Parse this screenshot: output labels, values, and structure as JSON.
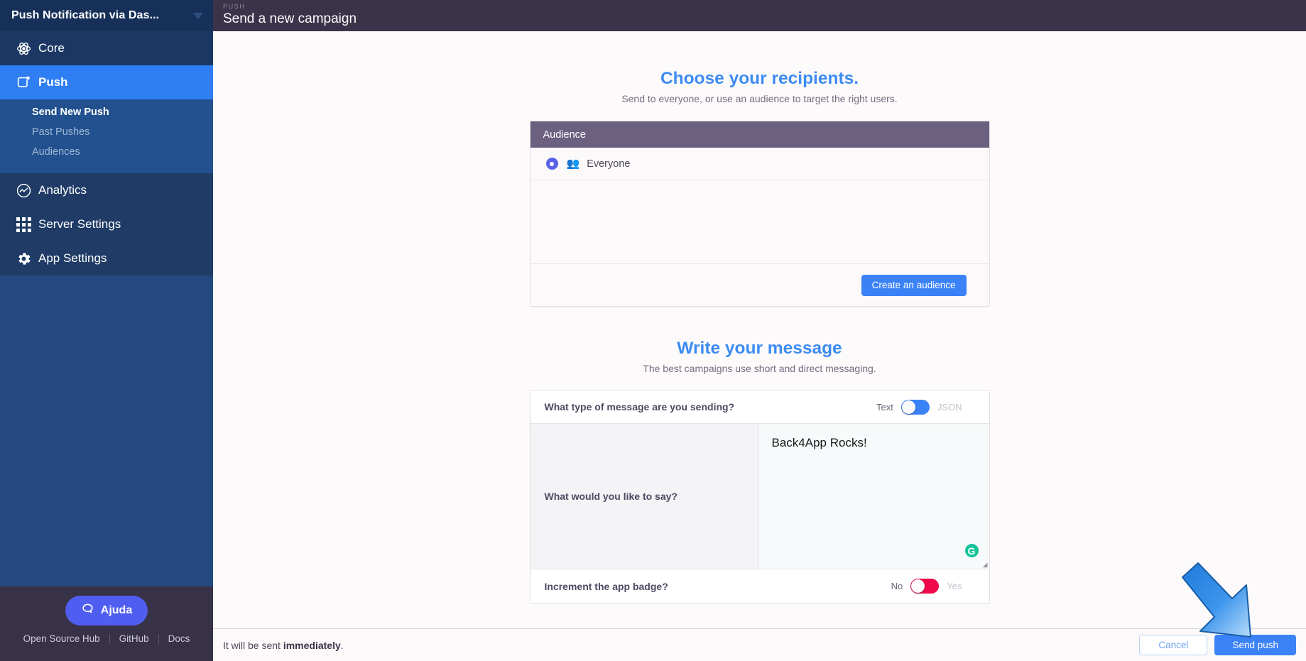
{
  "sidebar": {
    "app_title": "Push Notification via Das...",
    "dropdown_icon": "chevron-down-icon",
    "nav": [
      {
        "label": "Core",
        "icon": "atom-icon",
        "active": false
      },
      {
        "label": "Push",
        "icon": "push-bell-icon",
        "active": true
      },
      {
        "label": "Analytics",
        "icon": "analytics-chart-icon",
        "active": false
      },
      {
        "label": "Server Settings",
        "icon": "grid-apps-icon",
        "active": false
      },
      {
        "label": "App Settings",
        "icon": "gear-icon",
        "active": false
      }
    ],
    "subnav": [
      {
        "label": "Send New Push",
        "active": true
      },
      {
        "label": "Past Pushes",
        "active": false
      },
      {
        "label": "Audiences",
        "active": false
      }
    ],
    "help_button": {
      "label": "Ajuda",
      "icon": "chat-bubble-icon"
    },
    "footer_links": [
      "Open Source Hub",
      "GitHub",
      "Docs"
    ]
  },
  "topbar": {
    "eyebrow": "PUSH",
    "title": "Send a new campaign"
  },
  "recipients": {
    "title": "Choose your recipients.",
    "subtitle": "Send to everyone, or use an audience to target the right users.",
    "card_header": "Audience",
    "option_label": "Everyone",
    "option_icon": "people-group-icon",
    "option_selected": true,
    "create_button": "Create an audience"
  },
  "message": {
    "title": "Write your message",
    "subtitle": "The best campaigns use short and direct messaging.",
    "type_question": "What type of message are you sending?",
    "type_left_label": "Text",
    "type_right_label": "JSON",
    "type_selected": "Text",
    "say_question": "What would you like to say?",
    "say_value": "Back4App Rocks!",
    "grammarly_icon": "grammarly-icon",
    "badge_question": "Increment the app badge?",
    "badge_left_label": "No",
    "badge_right_label": "Yes",
    "badge_selected": "No"
  },
  "footerbar": {
    "note_prefix": "It will be sent ",
    "note_strong": "immediately",
    "note_suffix": ".",
    "cancel_label": "Cancel",
    "send_label": "Send push"
  },
  "annotation": {
    "arrow_icon": "arrow-pointing-down-right",
    "arrow_color": "#2f86e8"
  }
}
